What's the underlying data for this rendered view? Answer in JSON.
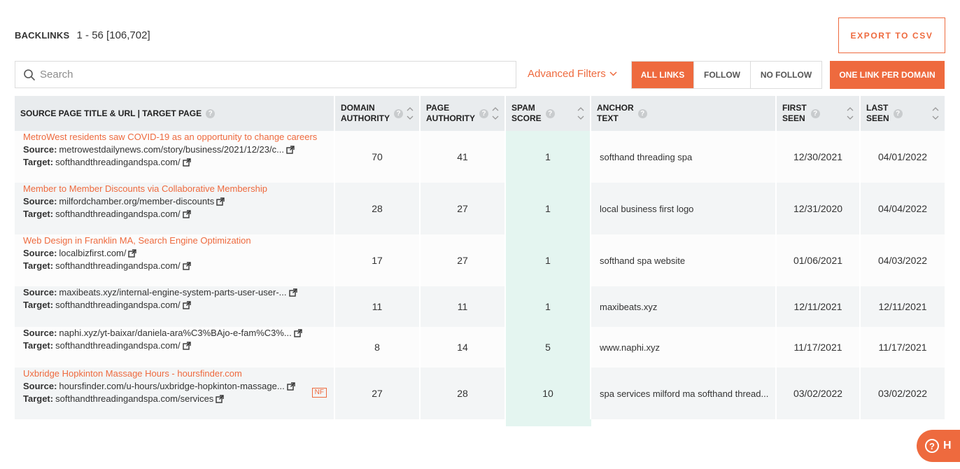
{
  "header": {
    "title": "BACKLINKS",
    "count": "1 - 56 [106,702]"
  },
  "export_label": "EXPORT TO CSV",
  "search": {
    "placeholder": "Search",
    "value": ""
  },
  "advanced_filters": "Advanced Filters",
  "link_filter": {
    "options": [
      "ALL LINKS",
      "FOLLOW",
      "NO FOLLOW"
    ],
    "selected": "ALL LINKS"
  },
  "one_link_label": "ONE LINK PER DOMAIN",
  "colors": {
    "accent": "#ee6a3e",
    "spam_bg": "#e4f5f0",
    "header_bg": "#e9ecee"
  },
  "columns": {
    "source": "SOURCE PAGE TITLE & URL | TARGET PAGE",
    "da": [
      "DOMAIN",
      "AUTHORITY"
    ],
    "pa": [
      "PAGE",
      "AUTHORITY"
    ],
    "spam": [
      "SPAM",
      "SCORE"
    ],
    "anchor": [
      "ANCHOR",
      "TEXT"
    ],
    "first": [
      "FIRST",
      "SEEN"
    ],
    "last": [
      "LAST",
      "SEEN"
    ]
  },
  "labels": {
    "source": "Source:",
    "target": "Target:",
    "nf": "NF"
  },
  "rows": [
    {
      "title": "MetroWest residents saw COVID-19 as an opportunity to change careers",
      "source": "metrowestdailynews.com/story/business/2021/12/23/c...",
      "target": "softhandthreadingandspa.com/",
      "nf": false,
      "da": "70",
      "pa": "41",
      "spam": "1",
      "anchor": "softhand threading spa",
      "first": "12/30/2021",
      "last": "04/01/2022"
    },
    {
      "title": "Member to Member Discounts via Collaborative Membership",
      "source": "milfordchamber.org/member-discounts",
      "target": "softhandthreadingandspa.com/",
      "nf": false,
      "da": "28",
      "pa": "27",
      "spam": "1",
      "anchor": "local business first logo",
      "first": "12/31/2020",
      "last": "04/04/2022"
    },
    {
      "title": "Web Design in Franklin MA, Search Engine Optimization",
      "source": "localbizfirst.com/",
      "target": "softhandthreadingandspa.com/",
      "nf": false,
      "da": "17",
      "pa": "27",
      "spam": "1",
      "anchor": "softhand spa website",
      "first": "01/06/2021",
      "last": "04/03/2022"
    },
    {
      "title": "",
      "source": "maxibeats.xyz/internal-engine-system-parts-user-user-...",
      "target": "softhandthreadingandspa.com/",
      "nf": false,
      "da": "11",
      "pa": "11",
      "spam": "1",
      "anchor": "maxibeats.xyz",
      "first": "12/11/2021",
      "last": "12/11/2021"
    },
    {
      "title": "",
      "source": "naphi.xyz/yt-baixar/daniela-ara%C3%BAjo-e-fam%C3%...",
      "target": "softhandthreadingandspa.com/",
      "nf": false,
      "da": "8",
      "pa": "14",
      "spam": "5",
      "anchor": "www.naphi.xyz",
      "first": "11/17/2021",
      "last": "11/17/2021"
    },
    {
      "title": "Uxbridge Hopkinton Massage Hours - hoursfinder.com",
      "source": "hoursfinder.com/u-hours/uxbridge-hopkinton-massage...",
      "target": "softhandthreadingandspa.com/services",
      "nf": true,
      "da": "27",
      "pa": "28",
      "spam": "10",
      "anchor": "spa services milford ma softhand thread...",
      "first": "03/02/2022",
      "last": "03/02/2022"
    }
  ],
  "help_label": "H"
}
